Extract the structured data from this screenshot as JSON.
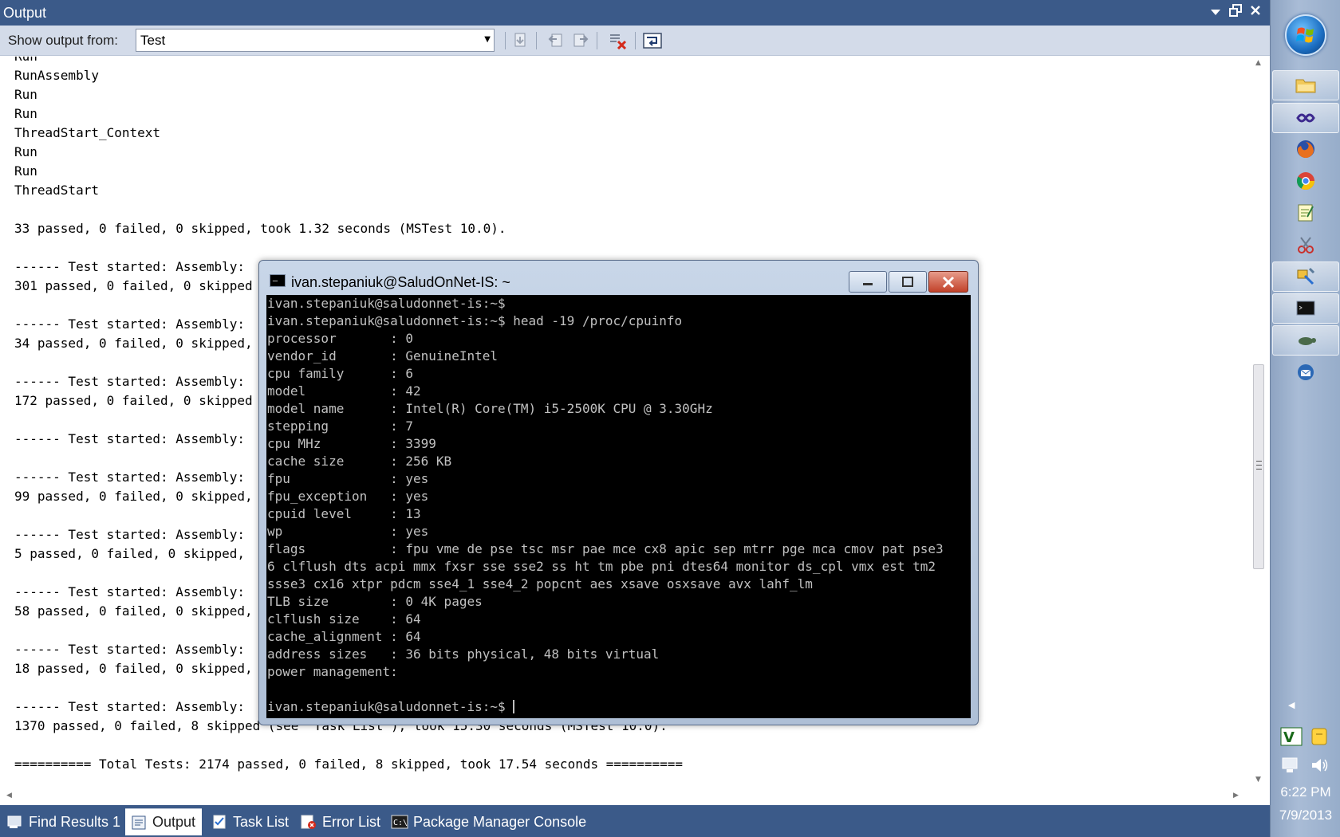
{
  "output_window": {
    "title": "Output",
    "toolbar": {
      "show_output_label": "Show output from:",
      "source_selected": "Test"
    },
    "lines": [
      "Run",
      "RunAssembly",
      "Run",
      "Run",
      "ThreadStart_Context",
      "Run",
      "Run",
      "ThreadStart",
      "",
      "33 passed, 0 failed, 0 skipped, took 1.32 seconds (MSTest 10.0).",
      "",
      "------ Test started: Assembly:",
      "301 passed, 0 failed, 0 skipped",
      "",
      "------ Test started: Assembly:",
      "34 passed, 0 failed, 0 skipped,",
      "",
      "------ Test started: Assembly:",
      "172 passed, 0 failed, 0 skipped",
      "",
      "------ Test started: Assembly:",
      "",
      "------ Test started: Assembly:",
      "99 passed, 0 failed, 0 skipped,",
      "",
      "------ Test started: Assembly:",
      "5 passed, 0 failed, 0 skipped,",
      "",
      "------ Test started: Assembly:",
      "58 passed, 0 failed, 0 skipped,",
      "",
      "------ Test started: Assembly:",
      "18 passed, 0 failed, 0 skipped,",
      "",
      "------ Test started: Assembly:",
      "1370 passed, 0 failed, 8 skipped (see 'Task List'), took 15.30 seconds (MSTest 10.0).",
      "",
      "========== Total Tests: 2174 passed, 0 failed, 8 skipped, took 17.54 seconds =========="
    ]
  },
  "bottom_tabs": [
    {
      "label": "Find Results 1",
      "icon": "find-results-icon",
      "active": false
    },
    {
      "label": "Output",
      "icon": "output-icon",
      "active": true
    },
    {
      "label": "Task List",
      "icon": "task-list-icon",
      "active": false
    },
    {
      "label": "Error List",
      "icon": "error-list-icon",
      "active": false
    },
    {
      "label": "Package Manager Console",
      "icon": "console-icon",
      "active": false
    }
  ],
  "terminal": {
    "title": "ivan.stepaniuk@SaludOnNet-IS: ~",
    "lines": [
      "ivan.stepaniuk@saludonnet-is:~$",
      "ivan.stepaniuk@saludonnet-is:~$ head -19 /proc/cpuinfo",
      "processor       : 0",
      "vendor_id       : GenuineIntel",
      "cpu family      : 6",
      "model           : 42",
      "model name      : Intel(R) Core(TM) i5-2500K CPU @ 3.30GHz",
      "stepping        : 7",
      "cpu MHz         : 3399",
      "cache size      : 256 KB",
      "fpu             : yes",
      "fpu_exception   : yes",
      "cpuid level     : 13",
      "wp              : yes",
      "flags           : fpu vme de pse tsc msr pae mce cx8 apic sep mtrr pge mca cmov pat pse3",
      "6 clflush dts acpi mmx fxsr sse sse2 ss ht tm pbe pni dtes64 monitor ds_cpl vmx est tm2",
      "ssse3 cx16 xtpr pdcm sse4_1 sse4_2 popcnt aes xsave osxsave avx lahf_lm",
      "TLB size        : 0 4K pages",
      "clflush size    : 64",
      "cache_alignment : 64",
      "address sizes   : 36 bits physical, 48 bits virtual",
      "power management:",
      ""
    ],
    "prompt": "ivan.stepaniuk@saludonnet-is:~$ "
  },
  "taskbar": {
    "time": "6:22 PM",
    "date": "7/9/2013"
  },
  "colors": {
    "vs_chrome": "#3b5a89",
    "toolbar": "#d3dbe9",
    "terminal_bg": "#000000",
    "terminal_fg": "#c0c0c0"
  }
}
